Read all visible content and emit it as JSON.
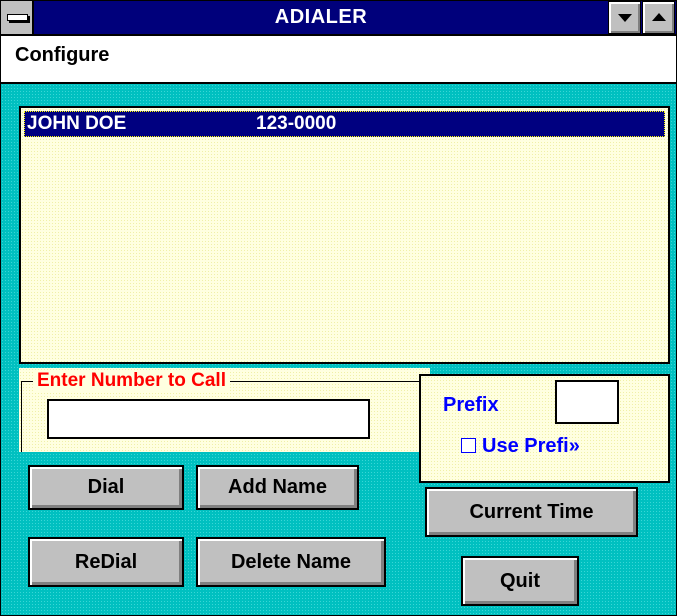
{
  "window": {
    "title": "ADIALER"
  },
  "menu": {
    "items": [
      {
        "label": "Configure"
      }
    ]
  },
  "list": {
    "rows": [
      {
        "name": "JOHN DOE",
        "phone": "123-0000",
        "selected": true
      }
    ]
  },
  "number_entry": {
    "group_label": "Enter Number to Call",
    "value": ""
  },
  "prefix": {
    "label": "Prefix",
    "value": "",
    "use_prefix_label": "Use Prefi»",
    "use_prefix_checked": false
  },
  "buttons": {
    "dial": "Dial",
    "redial": "ReDial",
    "add_name": "Add Name",
    "delete_name": "Delete Name",
    "current_time": "Current Time",
    "quit": "Quit"
  },
  "colors": {
    "title_bar": "#00007b",
    "client_background": "#00c0c0",
    "panel_background": "#ffffe0",
    "selection": "#000080",
    "group_label": "#ff0000",
    "prefix_text": "#0000ff"
  },
  "icons": {
    "system_menu": "system-menu-icon",
    "minimize": "minimize-arrow-icon",
    "maximize": "maximize-arrow-icon"
  }
}
